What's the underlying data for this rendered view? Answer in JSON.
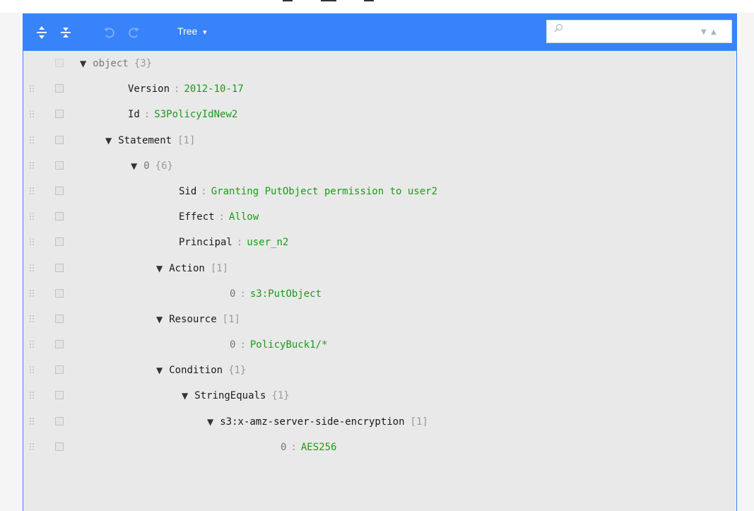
{
  "toolbar": {
    "icons": [
      "expand-all-icon",
      "collapse-all-icon",
      "undo-icon",
      "redo-icon"
    ],
    "mode_label": "Tree",
    "mode_caret": "▾"
  },
  "search": {
    "value": "",
    "placeholder": "",
    "next_glyph": "▼",
    "prev_glyph": "▲"
  },
  "colors": {
    "menu_bg": "#3883fa",
    "tree_bg": "#e9e9e9",
    "value_text": "#1a9b1a"
  },
  "tree": {
    "rows": [
      {
        "field": "object",
        "count": "{3}",
        "value": "",
        "expanded": true,
        "root": true
      },
      {
        "field": "Version",
        "count": "",
        "value": "2012-10-17"
      },
      {
        "field": "Id",
        "count": "",
        "value": "S3PolicyIdNew2"
      },
      {
        "field": "Statement",
        "count": "[1]",
        "value": "",
        "expanded": true
      },
      {
        "field": "0",
        "count": "{6}",
        "value": "",
        "expanded": true,
        "index": true
      },
      {
        "field": "Sid",
        "count": "",
        "value": "Granting PutObject permission to user2"
      },
      {
        "field": "Effect",
        "count": "",
        "value": "Allow"
      },
      {
        "field": "Principal",
        "count": "",
        "value": "user_n2"
      },
      {
        "field": "Action",
        "count": "[1]",
        "value": "",
        "expanded": true
      },
      {
        "field": "0",
        "count": "",
        "value": "s3:PutObject",
        "index": true
      },
      {
        "field": "Resource",
        "count": "[1]",
        "value": "",
        "expanded": true
      },
      {
        "field": "0",
        "count": "",
        "value": "PolicyBuck1/*",
        "index": true
      },
      {
        "field": "Condition",
        "count": "{1}",
        "value": "",
        "expanded": true
      },
      {
        "field": "StringEquals",
        "count": "{1}",
        "value": "",
        "expanded": true
      },
      {
        "field": "s3:x-amz-server-side-encryption",
        "count": "[1]",
        "value": "",
        "expanded": true
      },
      {
        "field": "0",
        "count": "",
        "value": "AES256",
        "index": true
      }
    ]
  }
}
